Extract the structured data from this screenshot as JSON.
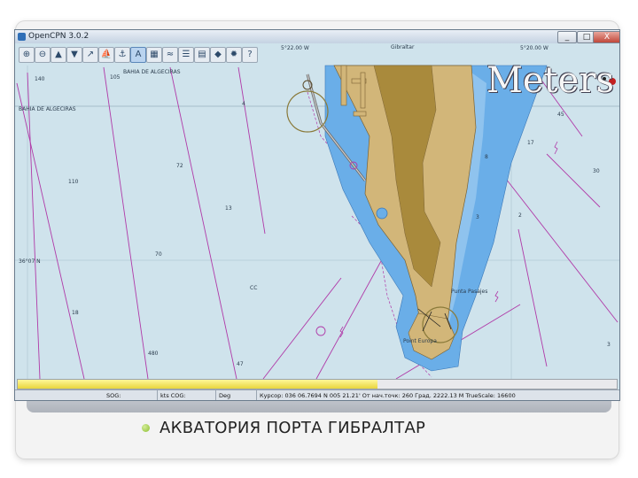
{
  "window": {
    "title": "OpenCPN 3.0.2",
    "min_label": "_",
    "max_label": "□",
    "close_label": "X"
  },
  "toolbar": {
    "icons": [
      "zoom-in-icon",
      "zoom-out-icon",
      "scale-in-icon",
      "scale-out-icon",
      "route-icon",
      "ship-icon",
      "follow-icon",
      "text-icon",
      "chart-icon",
      "tide-icon",
      "settings-icon",
      "print-icon",
      "track-icon",
      "waypoint-icon",
      "help-icon"
    ]
  },
  "chart": {
    "scale_banner": "Meters",
    "labels": {
      "bahia_top": "BAHIA DE ALGECIRAS",
      "bahia_left": "BAHIA DE ALGECIRAS",
      "gibraltar": "Gibraltar",
      "punta": "Punta Pasajes",
      "point_south": "Point Europa",
      "lon_left": "5°22.00 W",
      "lon_right": "5°20.00 W",
      "lat_mid": "36°07 N",
      "d140": "140",
      "d105": "105",
      "d110": "110",
      "d72": "72",
      "d13": "13",
      "d70": "70",
      "d18": "18",
      "d480": "480",
      "d47": "47",
      "d4": "4",
      "d30": "30",
      "d45": "45",
      "d17": "17",
      "d3": "3",
      "d8": "8",
      "d2": "2",
      "d3b": "3",
      "cc": "CC"
    },
    "colors": {
      "sea": "#cfe3ec",
      "shallow": "#6aaee8",
      "land": "#d2b679",
      "land_dark": "#a98a3c",
      "boundary": "#b03aa8",
      "route": "#8a3fa8"
    }
  },
  "progress": {
    "value": 0.6
  },
  "status": {
    "sog": "SOG:",
    "sog_unit": "kts COG:",
    "deg": "Deg",
    "cursor": "Курсор: 036 06.7694 N 005 21.21' От нач.точк: 260 Град. 2222.13 М TrueScale: 16600"
  },
  "caption": {
    "text": "АКВАТОРИЯ ПОРТА ГИБРАЛТАР"
  }
}
